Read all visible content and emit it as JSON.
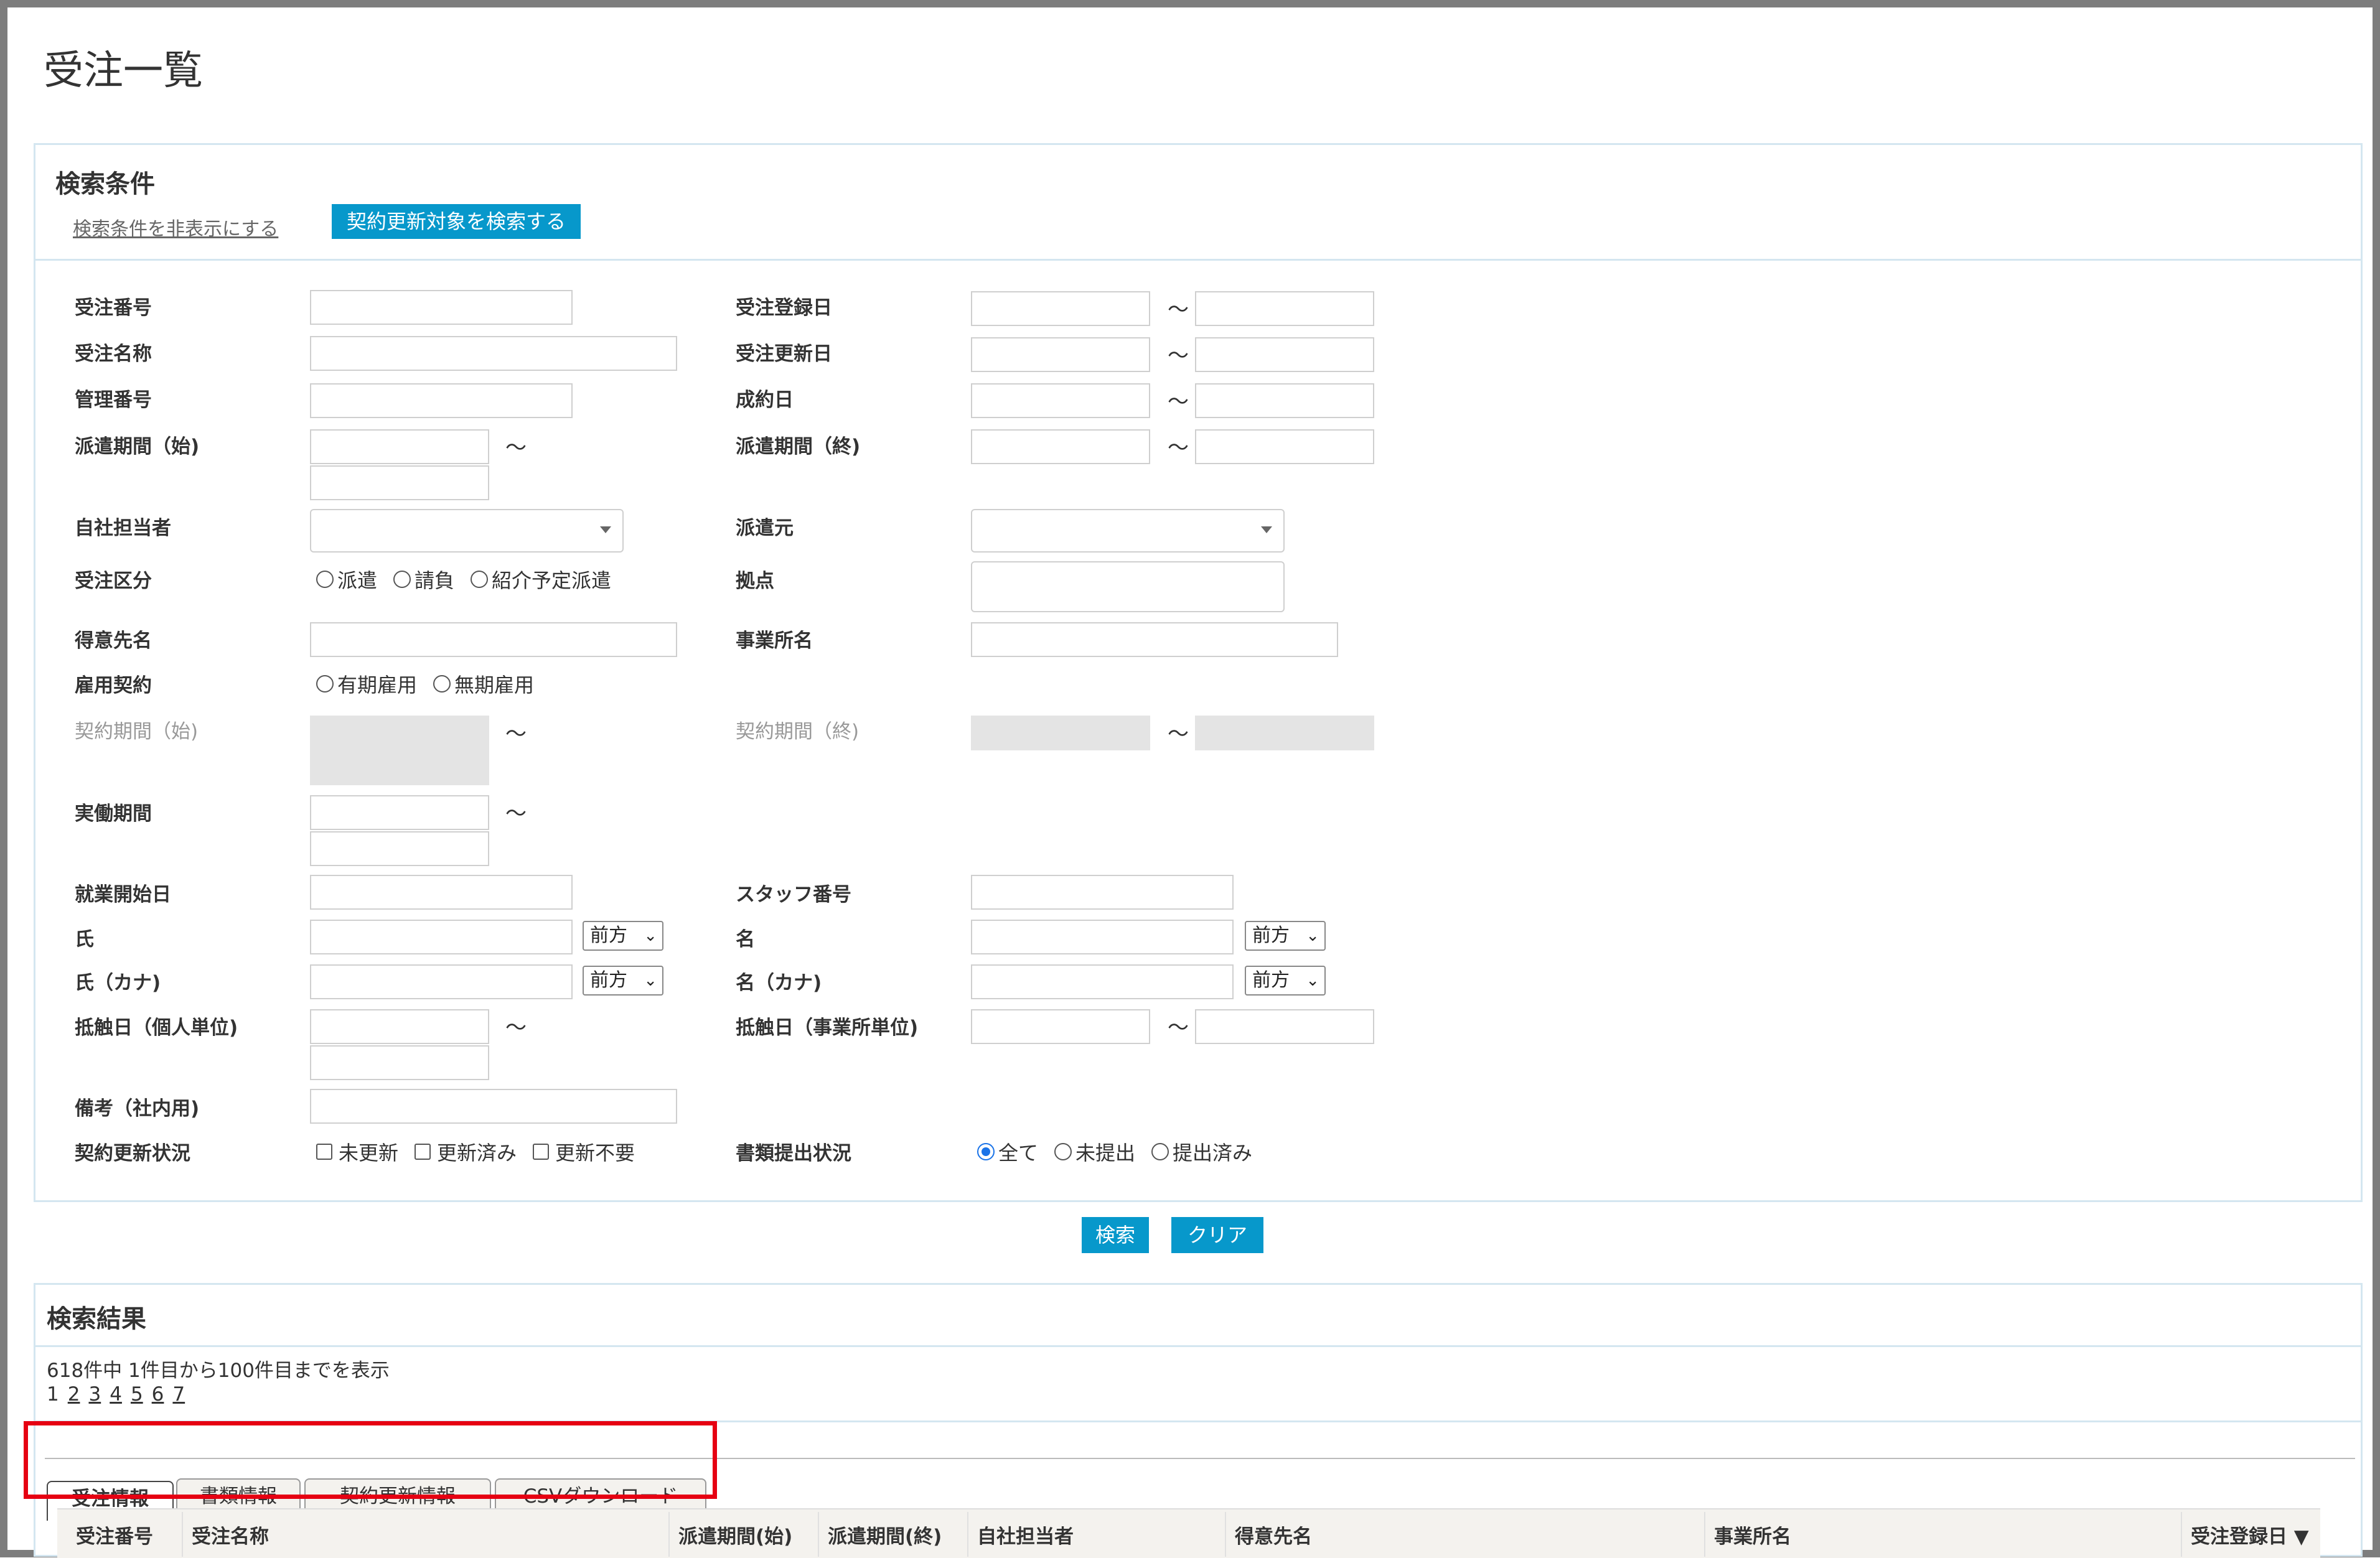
{
  "page": {
    "title": "受注一覧"
  },
  "search": {
    "title": "検索条件",
    "hide_link": "検索条件を非表示にする",
    "renewal_button": "契約更新対象を検索する",
    "tilde": "〜",
    "labels": {
      "order_no": "受注番号",
      "order_name": "受注名称",
      "mgmt_no": "管理番号",
      "dispatch_start": "派遣期間（始)",
      "staff_in_charge": "自社担当者",
      "order_type": "受注区分",
      "customer": "得意先名",
      "employment": "雇用契約",
      "contract_start": "契約期間（始)",
      "actual_period": "実働期間",
      "work_start": "就業開始日",
      "last_name": "氏",
      "last_name_kana": "氏（カナ)",
      "contact_person": "抵触日（個人単位)",
      "remarks": "備考（社内用)",
      "renewal_status": "契約更新状況",
      "reg_date": "受注登録日",
      "upd_date": "受注更新日",
      "deal_date": "成約日",
      "dispatch_end": "派遣期間（終)",
      "dispatch_source": "派遣元",
      "base": "拠点",
      "office": "事業所名",
      "contract_end": "契約期間（終)",
      "staff_no": "スタッフ番号",
      "first_name": "名",
      "first_name_kana": "名（カナ)",
      "contact_office": "抵触日（事業所単位)",
      "doc_status": "書類提出状況"
    },
    "order_type_options": [
      "派遣",
      "請負",
      "紹介予定派遣"
    ],
    "employment_options": [
      "有期雇用",
      "無期雇用"
    ],
    "renewal_options": [
      "未更新",
      "更新済み",
      "更新不要"
    ],
    "doc_options": [
      "全て",
      "未提出",
      "提出済み"
    ],
    "match_mode": "前方",
    "search_button": "検索",
    "clear_button": "クリア"
  },
  "results": {
    "title": "検索結果",
    "count_text": "618件中 1件目から100件目までを表示",
    "pages": [
      "1",
      "2",
      "3",
      "4",
      "5",
      "6",
      "7"
    ],
    "tabs": [
      "受注情報",
      "書類情報",
      "契約更新情報",
      "CSVダウンロード"
    ],
    "columns": [
      "受注番号",
      "受注名称",
      "派遣期間(始)",
      "派遣期間(終)",
      "自社担当者",
      "得意先名",
      "事業所名",
      "受注登録日 ▼"
    ]
  }
}
